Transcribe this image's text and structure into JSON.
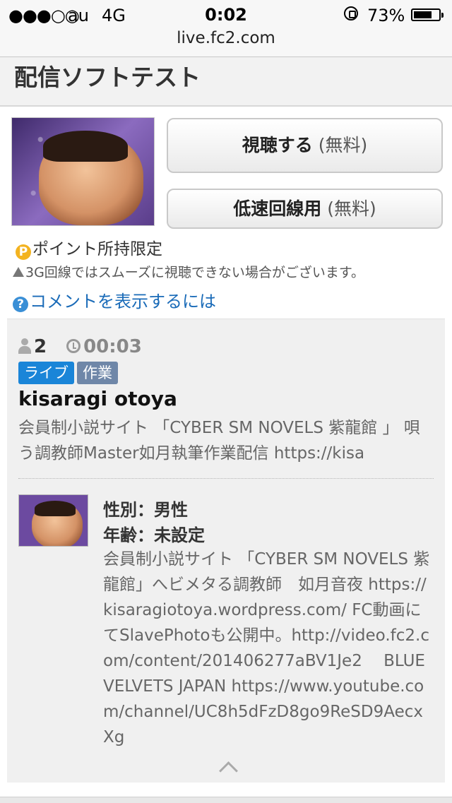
{
  "status_bar": {
    "signal": "●●●○○",
    "carrier": "au",
    "network": "4G",
    "time": "0:02",
    "battery_percent_label": "73%",
    "battery_level": 0.73
  },
  "browser": {
    "url": "live.fc2.com"
  },
  "page": {
    "title": "配信ソフトテスト"
  },
  "actions": {
    "watch_label": "視聴する",
    "watch_price": "(無料)",
    "lowspeed_label": "低速回線用",
    "lowspeed_price": "(無料)"
  },
  "notes": {
    "points_icon": "P",
    "points_text": "ポイント所持限定",
    "warning_text": "3G回線ではスムーズに視聴できない場合がございます。",
    "help_icon": "?",
    "comment_help": "コメントを表示するには"
  },
  "stream": {
    "viewers": "2",
    "elapsed": "00:03",
    "tags": [
      "ライブ",
      "作業"
    ],
    "username": "kisaragi otoya",
    "description": "会員制小説サイト 「CYBER SM NOVELS 紫龍館 」 唄う調教師Master如月執筆作業配信 https://kisa"
  },
  "profile": {
    "gender": "性別：男性",
    "age": "年齢：未設定",
    "bio": "会員制小説サイト 「CYBER SM NOVELS 紫龍館」へビメタる調教師　如月音夜 https://kisaragiotoya.wordpress.com/ FC動画にてSlavePhotoも公開中。http://video.fc2.com/content/201406277aBV1Je2　 BLUE VELVETS JAPAN https://www.youtube.com/channel/UC8h5dFzD8go9ReSD9AecxXg"
  },
  "colors": {
    "link": "#1a6bb8",
    "tag_live": "#1a85d8",
    "tag_work": "#6f87a8",
    "points": "#f3b320"
  }
}
